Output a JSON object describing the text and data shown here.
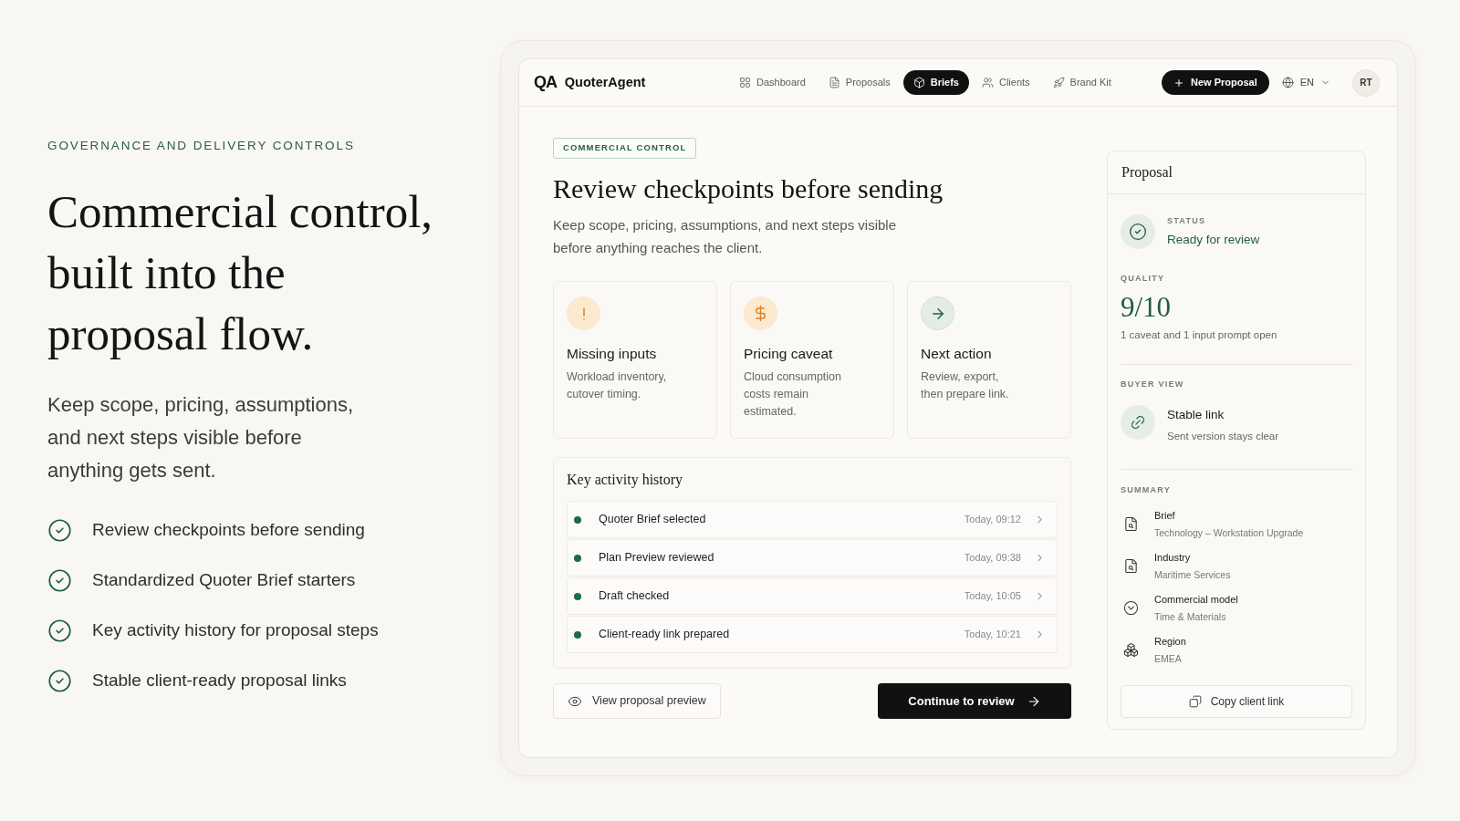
{
  "intro": {
    "eyebrow": "GOVERNANCE AND DELIVERY CONTROLS",
    "headline": "Commercial control, built into the proposal flow.",
    "body": "Keep scope, pricing, assumptions, and next steps visible before anything gets sent.",
    "features": [
      "Review checkpoints before sending",
      "Standardized Quoter Brief starters",
      "Key activity history for proposal steps",
      "Stable client-ready proposal links"
    ]
  },
  "header": {
    "logo_mark": "QA",
    "brand": "QuoterAgent",
    "nav": [
      {
        "label": "Dashboard",
        "selected": false
      },
      {
        "label": "Proposals",
        "selected": false
      },
      {
        "label": "Briefs",
        "selected": true
      },
      {
        "label": "Clients",
        "selected": false
      },
      {
        "label": "Brand Kit",
        "selected": false
      }
    ],
    "new_button": "New Proposal",
    "language": "EN",
    "avatar": "RT"
  },
  "main": {
    "badge": "COMMERCIAL CONTROL",
    "title": "Review checkpoints before sending",
    "subtitle": "Keep scope, pricing, assumptions, and next steps visible before anything reaches the client.",
    "checkpoints": [
      {
        "kind": "missing",
        "title": "Missing inputs",
        "text": "Workload inventory,\ncutover timing."
      },
      {
        "kind": "pricing",
        "title": "Pricing caveat",
        "text": "Cloud consumption\ncosts remain\nestimated."
      },
      {
        "kind": "next",
        "title": "Next action",
        "text": "Review, export,\nthen prepare link."
      }
    ],
    "activity": {
      "title": "Key activity history",
      "rows": [
        {
          "label": "Quoter Brief selected",
          "time": "Today, 09:12"
        },
        {
          "label": "Plan Preview reviewed",
          "time": "Today, 09:38"
        },
        {
          "label": "Draft checked",
          "time": "Today, 10:05"
        },
        {
          "label": "Client-ready link prepared",
          "time": "Today, 10:21"
        }
      ]
    },
    "secondary_button": "View proposal preview",
    "primary_button": "Continue to review"
  },
  "panel": {
    "title": "Proposal",
    "status_label": "STATUS",
    "status": "Ready for review",
    "quality_label": "QUALITY",
    "quality": "9/10",
    "quality_note": "1 caveat and 1 input prompt open",
    "buyer_label": "BUYER VIEW",
    "buyer_title": "Stable link",
    "buyer_note": "Sent version stays clear",
    "summary_label": "SUMMARY",
    "summary": [
      {
        "label": "Brief",
        "value": "Technology – Workstation Upgrade"
      },
      {
        "label": "Industry",
        "value": "Maritime Services"
      },
      {
        "label": "Commercial model",
        "value": "Time & Materials"
      },
      {
        "label": "Region",
        "value": "EMEA"
      }
    ],
    "copy_button": "Copy client link"
  }
}
